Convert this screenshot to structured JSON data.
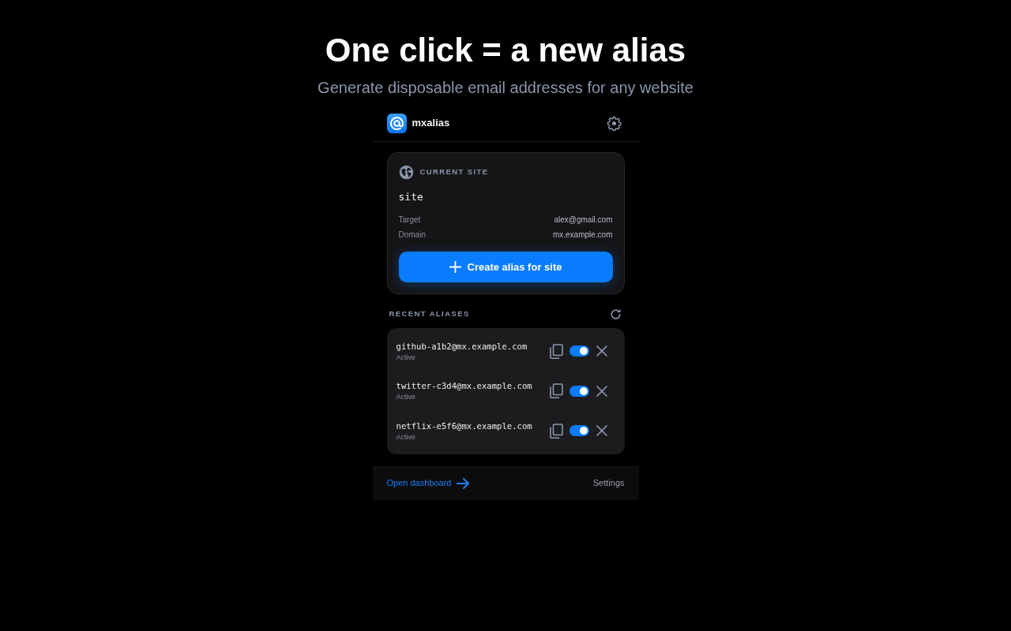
{
  "hero": {
    "title": "One click = a new alias",
    "subtitle": "Generate disposable email addresses for any website"
  },
  "popup": {
    "header": {
      "app_name": "mxalias"
    },
    "current_site": {
      "heading": "CURRENT SITE",
      "site": "site",
      "details": [
        {
          "label": "Target",
          "value": "alex@gmail.com"
        },
        {
          "label": "Domain",
          "value": "mx.example.com"
        }
      ],
      "button": "Create alias for site"
    },
    "recent": {
      "heading": "RECENT ALIASES",
      "aliases": [
        {
          "address": "github-a1b2@mx.example.com",
          "status": "Active",
          "on": true
        },
        {
          "address": "twitter-c3d4@mx.example.com",
          "status": "Active",
          "on": true
        },
        {
          "address": "netflix-e5f6@mx.example.com",
          "status": "Active",
          "on": true
        }
      ]
    },
    "footer": {
      "link": "Open dashboard",
      "settings": "Settings"
    }
  }
}
